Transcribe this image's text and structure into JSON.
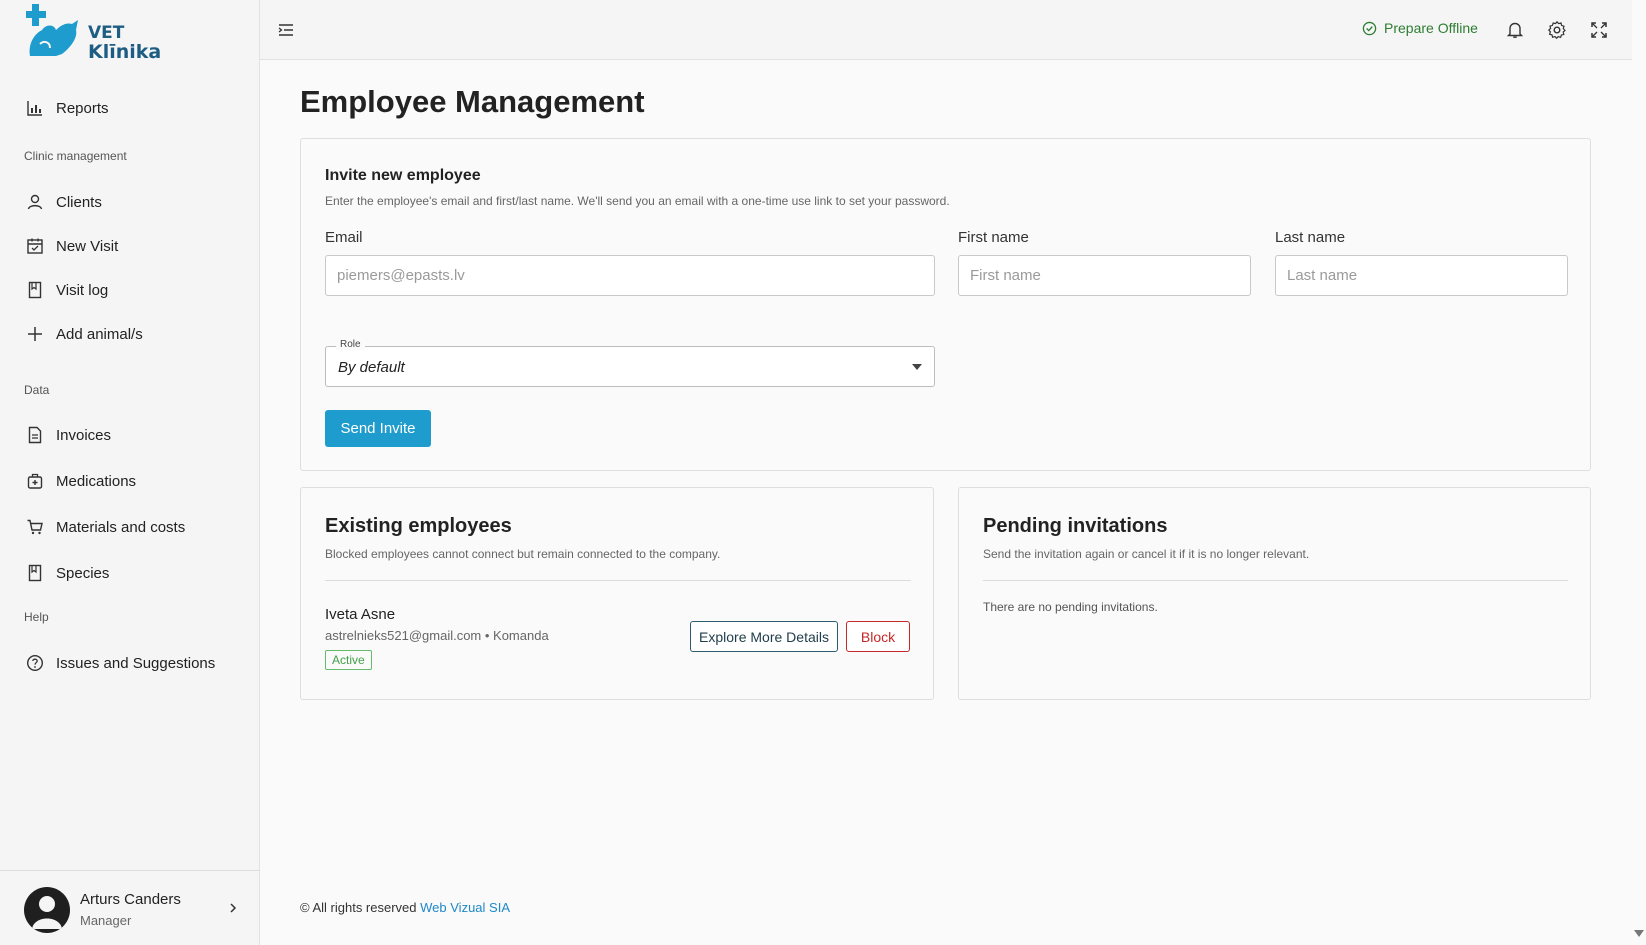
{
  "brand": {
    "line1": "VET",
    "line2": "Klīnika",
    "color": "#1d5d83"
  },
  "sidebar": {
    "top_items": [
      {
        "label": "Reports",
        "icon": "bar-chart-icon"
      }
    ],
    "sections": [
      {
        "title": "Clinic management",
        "items": [
          {
            "label": "Clients",
            "icon": "user-icon"
          },
          {
            "label": "New Visit",
            "icon": "calendar-icon"
          },
          {
            "label": "Visit log",
            "icon": "bookmark-icon"
          },
          {
            "label": "Add animal/s",
            "icon": "plus-icon"
          }
        ]
      },
      {
        "title": "Data",
        "items": [
          {
            "label": "Invoices",
            "icon": "document-icon"
          },
          {
            "label": "Medications",
            "icon": "medical-bag-icon"
          },
          {
            "label": "Materials and costs",
            "icon": "cart-icon"
          },
          {
            "label": "Species",
            "icon": "bookmark-icon"
          }
        ]
      },
      {
        "title": "Help",
        "items": [
          {
            "label": "Issues and Suggestions",
            "icon": "help-circle-icon"
          }
        ]
      }
    ],
    "user": {
      "name": "Arturs Canders",
      "role": "Manager"
    }
  },
  "topbar": {
    "offline_label": "Prepare Offline",
    "offline_color": "#2e7d32"
  },
  "page": {
    "title": "Employee Management"
  },
  "invite": {
    "title": "Invite new employee",
    "description": "Enter the employee's email and first/last name. We'll send you an email with a one-time use link to set your password.",
    "email_label": "Email",
    "email_placeholder": "piemers@epasts.lv",
    "first_name_label": "First name",
    "first_name_placeholder": "First name",
    "last_name_label": "Last name",
    "last_name_placeholder": "Last name",
    "role_label": "Role",
    "role_value": "By default",
    "submit_label": "Send Invite",
    "accent": "#1e9ccd"
  },
  "existing": {
    "title": "Existing employees",
    "description": "Blocked employees cannot connect but remain connected to the company.",
    "employees": [
      {
        "name": "Iveta Asne",
        "meta": "astrelnieks521@gmail.com • Komanda",
        "status": "Active",
        "details_label": "Explore More Details",
        "block_label": "Block"
      }
    ]
  },
  "pending": {
    "title": "Pending invitations",
    "description": "Send the invitation again or cancel it if it is no longer relevant.",
    "empty_text": "There are no pending invitations."
  },
  "footer": {
    "text": "© All rights reserved",
    "link": "Web Vizual SIA"
  }
}
